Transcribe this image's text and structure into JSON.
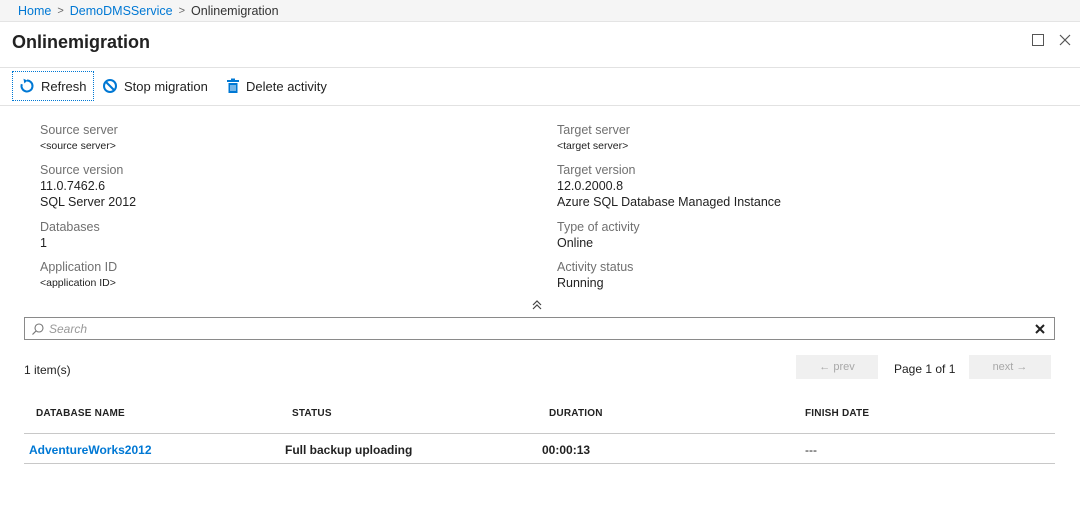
{
  "breadcrumb": {
    "items": [
      "Home",
      "DemoDMSService",
      "Onlinemigration"
    ]
  },
  "header": {
    "title": "Onlinemigration"
  },
  "toolbar": {
    "refresh_label": "Refresh",
    "stop_label": "Stop migration",
    "delete_label": "Delete activity"
  },
  "properties": {
    "source_server": {
      "label": "Source server",
      "value": "<source server>"
    },
    "source_version": {
      "label": "Source version",
      "value": "11.0.7462.6",
      "value2": "SQL Server 2012"
    },
    "databases": {
      "label": "Databases",
      "value": "1"
    },
    "application_id": {
      "label": "Application ID",
      "value": "<application ID>"
    },
    "target_server": {
      "label": "Target server",
      "value": "<target server>"
    },
    "target_version": {
      "label": "Target version",
      "value": "12.0.2000.8",
      "value2": "Azure SQL Database Managed Instance"
    },
    "activity_type": {
      "label": "Type of activity",
      "value": "Online"
    },
    "activity_status": {
      "label": "Activity status",
      "value": "Running"
    }
  },
  "search": {
    "placeholder": "Search"
  },
  "list": {
    "count": "1 item(s)",
    "prev_label": "← prev",
    "page_info": "Page 1 of 1",
    "next_label": "next →",
    "columns": [
      "DATABASE NAME",
      "STATUS",
      "DURATION",
      "FINISH DATE"
    ],
    "rows": [
      {
        "name": "AdventureWorks2012",
        "status": "Full backup uploading",
        "duration": "00:00:13",
        "finish": "---"
      }
    ]
  },
  "colors": {
    "accent": "#0078d4"
  }
}
